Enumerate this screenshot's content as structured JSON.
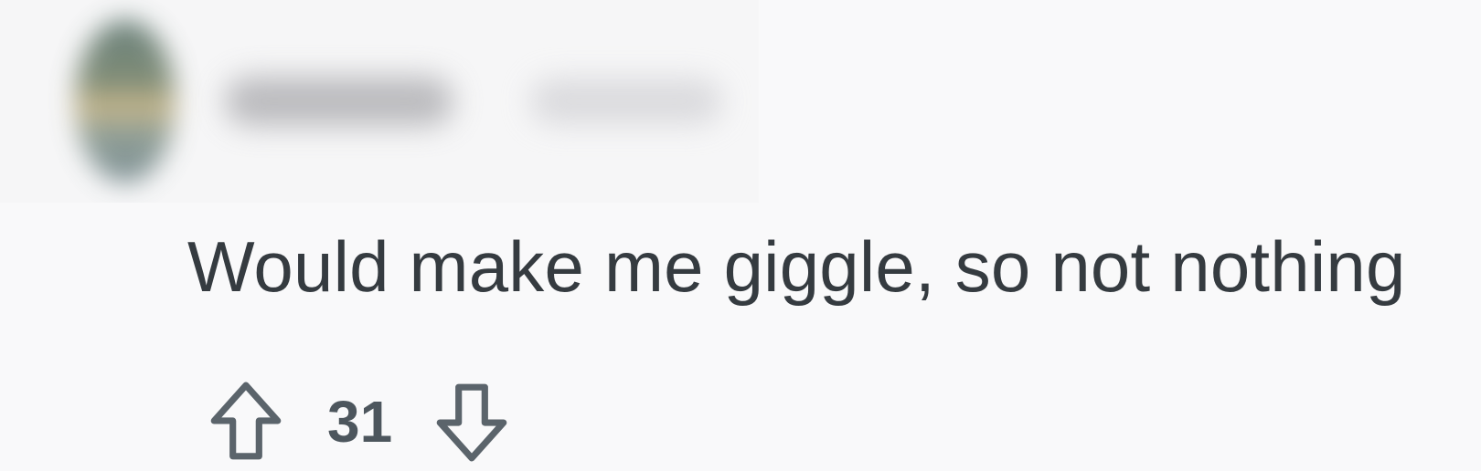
{
  "comment": {
    "body": "Would make me giggle, so not nothing",
    "score": "31"
  },
  "icons": {
    "upvote": "arrow-up-outline-icon",
    "downvote": "arrow-down-outline-icon"
  },
  "colors": {
    "background": "#f9f9fa",
    "text": "#353b40",
    "icon": "#5b646b"
  }
}
